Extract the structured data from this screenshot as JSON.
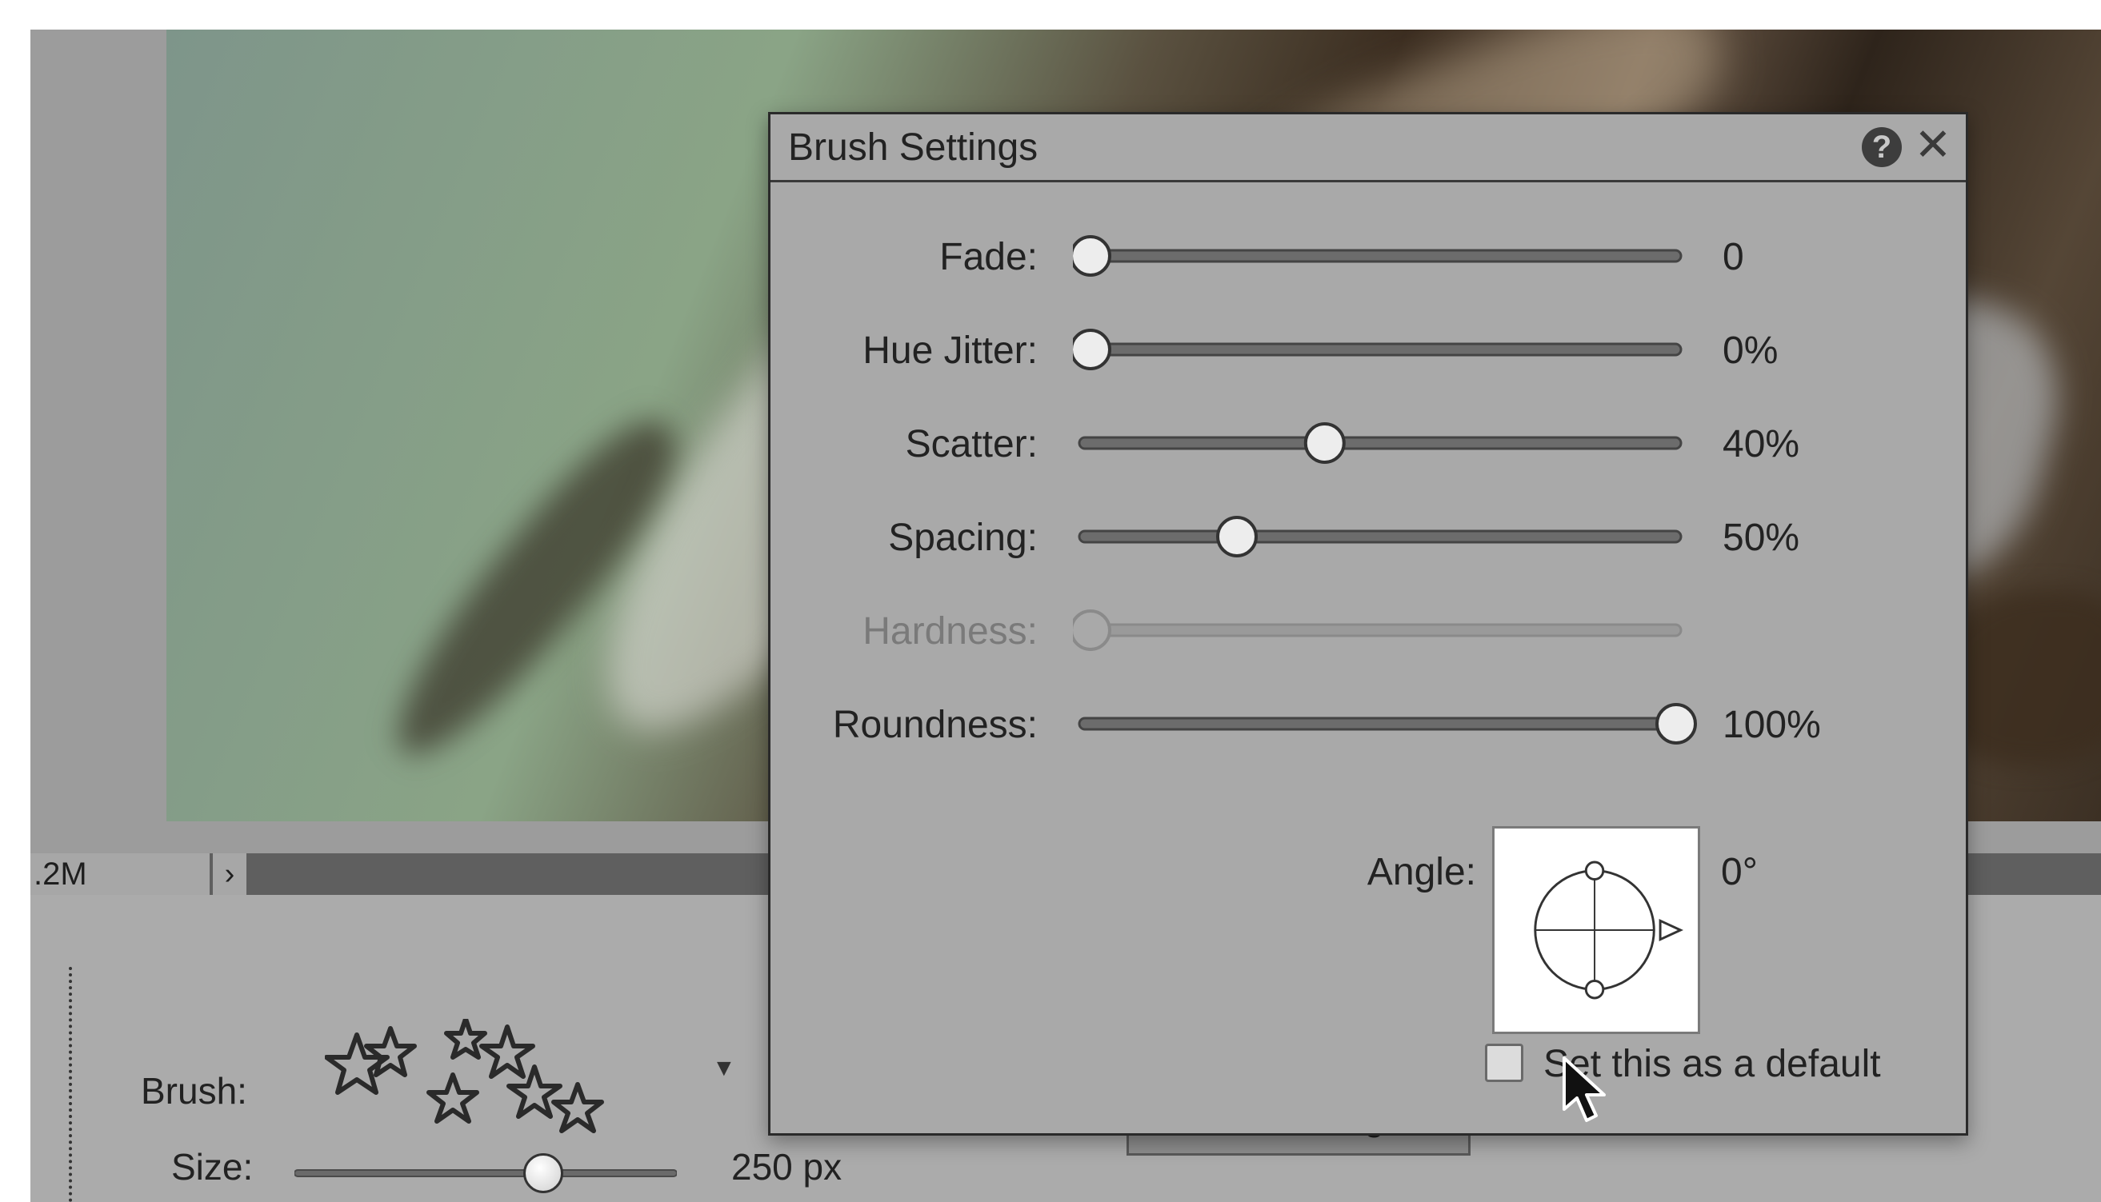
{
  "status_bar": {
    "size_text": ".2M",
    "arrow_icon": "chevron-right-icon"
  },
  "options_bar": {
    "brush_label": "Brush:",
    "size_label": "Size:",
    "size_value": "250 px",
    "size_slider_fraction": 0.65,
    "brush_settings_button": "Brush Settings..."
  },
  "dialog": {
    "title": "Brush Settings",
    "help_symbol": "?",
    "close_symbol": "✕",
    "sliders": [
      {
        "label": "Fade:",
        "value": "0",
        "fraction": 0.0,
        "enabled": true
      },
      {
        "label": "Hue Jitter:",
        "value": "0%",
        "fraction": 0.0,
        "enabled": true
      },
      {
        "label": "Scatter:",
        "value": "40%",
        "fraction": 0.4,
        "enabled": true
      },
      {
        "label": "Spacing:",
        "value": "50%",
        "fraction": 0.25,
        "enabled": true
      },
      {
        "label": "Hardness:",
        "value": "",
        "fraction": 0.0,
        "enabled": false
      },
      {
        "label": "Roundness:",
        "value": "100%",
        "fraction": 1.0,
        "enabled": true
      }
    ],
    "angle_label": "Angle:",
    "angle_value": "0°",
    "default_checkbox_label": "Set this as a default",
    "default_checked": false
  }
}
